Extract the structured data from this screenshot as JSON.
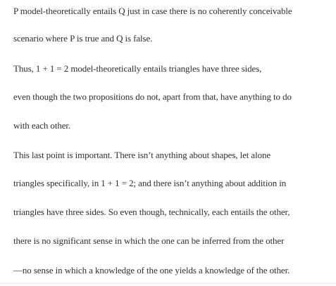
{
  "document": {
    "paragraphs": [
      {
        "lines": [
          "P model-theoretically entails Q just in case there is no coherently conceivable",
          "scenario where P is true and Q is false."
        ]
      },
      {
        "lines": [
          "Thus, 1 + 1 = 2 model-theoretically entails triangles have three sides,",
          "even though the two propositions do not, apart from that, have anything to do",
          "with each other."
        ]
      },
      {
        "lines": [
          "This last point is important. There isn’t anything about shapes, let alone",
          "triangles specifically, in 1 + 1 = 2; and there isn’t anything about addition in",
          "triangles have three sides. So even though, technically, each entails the other,",
          "there is no significant sense in which the one can be inferred from the other",
          "—no sense in which a knowledge of the one yields a knowledge of the other."
        ]
      }
    ]
  }
}
